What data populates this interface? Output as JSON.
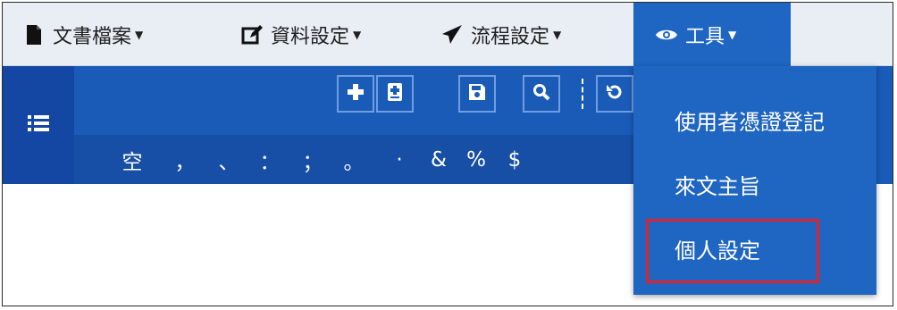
{
  "menubar": {
    "items": [
      {
        "label": "文書檔案",
        "icon": "document-icon"
      },
      {
        "label": "資料設定",
        "icon": "edit-icon"
      },
      {
        "label": "流程設定",
        "icon": "send-icon"
      },
      {
        "label": "工具",
        "icon": "eye-icon",
        "active": true
      }
    ]
  },
  "toolbar": {
    "buttons": [
      "add-icon",
      "add-document-icon",
      "save-icon",
      "search-icon",
      "undo-icon"
    ]
  },
  "punctuation": {
    "items": [
      "空",
      "，",
      "、",
      "：",
      "；",
      "。",
      "·",
      "&",
      "%",
      "$"
    ]
  },
  "tools_menu": {
    "items": [
      "使用者憑證登記",
      "來文主旨",
      "個人設定"
    ],
    "highlighted_index": 2
  },
  "colors": {
    "menubar_bg": "#e9eef5",
    "primary_blue": "#1f66c2",
    "dark_blue": "#1447a3",
    "highlight_red": "#e0232b"
  }
}
